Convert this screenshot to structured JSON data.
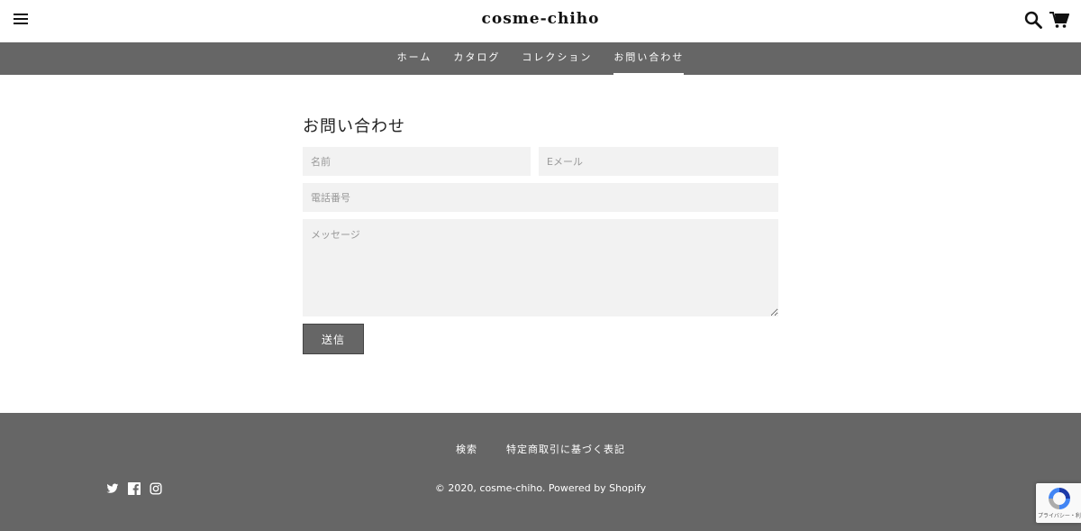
{
  "header": {
    "logo": "cosme-chiho",
    "menu_icon": "hamburger-menu-icon",
    "search_icon": "search-icon",
    "cart_icon": "cart-icon"
  },
  "nav": {
    "items": [
      {
        "label": "ホーム",
        "active": false
      },
      {
        "label": "カタログ",
        "active": false
      },
      {
        "label": "コレクション",
        "active": false
      },
      {
        "label": "お問い合わせ",
        "active": true
      }
    ]
  },
  "contact": {
    "title": "お問い合わせ",
    "name_placeholder": "名前",
    "email_placeholder": "Eメール",
    "phone_placeholder": "電話番号",
    "message_placeholder": "メッセージ",
    "submit_label": "送信"
  },
  "footer": {
    "links": [
      "検索",
      "特定商取引に基づく表記"
    ],
    "copyright": "© 2020, cosme-chiho. Powered by Shopify",
    "social_icons": [
      "twitter-icon",
      "facebook-icon",
      "instagram-icon"
    ]
  },
  "recaptcha": {
    "text": "プライバシー・利用規約"
  },
  "colors": {
    "nav_bg": "#666666",
    "footer_bg": "#666666",
    "field_bg": "#f2f2f2",
    "button_bg": "#666666"
  }
}
